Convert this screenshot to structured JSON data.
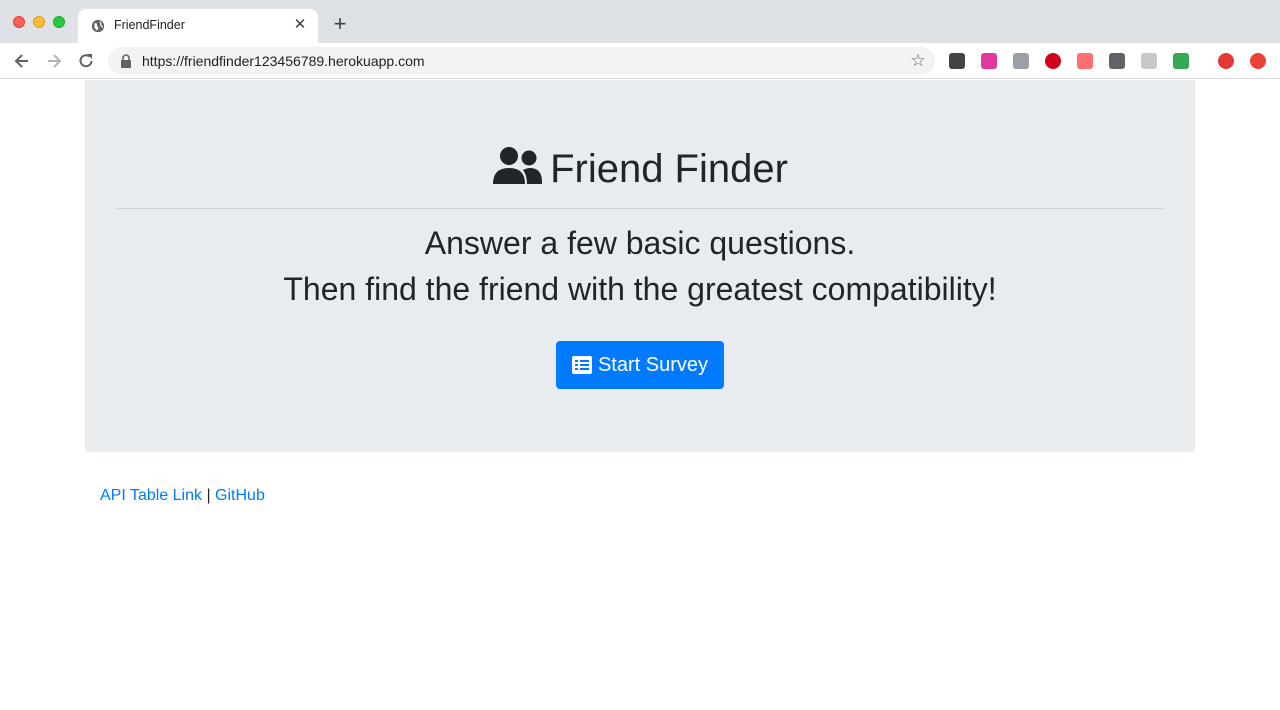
{
  "browser": {
    "tab_title": "FriendFinder",
    "url": "https://friendfinder123456789.herokuapp.com",
    "extensions": [
      {
        "name": "ext-dark-icon",
        "color": "#444444"
      },
      {
        "name": "ext-grammarly-icon",
        "color": "#e0399a"
      },
      {
        "name": "ext-gray-icon",
        "color": "#9aa0a6"
      },
      {
        "name": "ext-adblock-plus-icon",
        "color": "#d0021b"
      },
      {
        "name": "ext-arrow-icon",
        "color": "#ff6f6f"
      },
      {
        "name": "ext-code-icon",
        "color": "#5f6368"
      },
      {
        "name": "ext-grid-icon",
        "color": "#c8c8c8"
      },
      {
        "name": "ext-chart-icon",
        "color": "#34a853"
      },
      {
        "name": "ext-avatar-icon",
        "color": "#e53935"
      },
      {
        "name": "ext-upload-icon",
        "color": "#ea4335"
      }
    ]
  },
  "jumbotron": {
    "title": "Friend Finder",
    "lead_line1": "Answer a few basic questions.",
    "lead_line2": "Then find the friend with the greatest compatibility!",
    "button_label": "Start Survey"
  },
  "footer": {
    "api_link": "API Table Link",
    "separator": " | ",
    "github_link": "GitHub"
  },
  "colors": {
    "primary": "#007bff",
    "jumbotron_bg": "#e9ecef",
    "text": "#212529"
  }
}
